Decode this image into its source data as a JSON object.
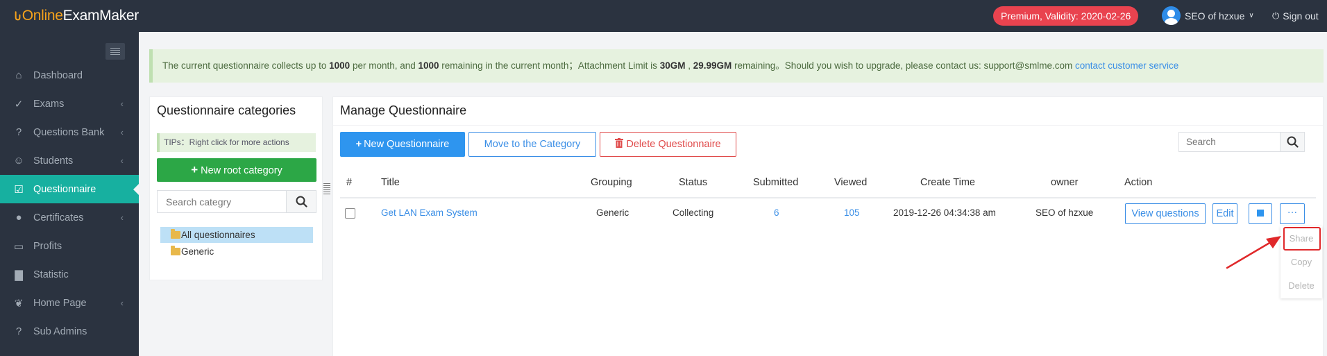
{
  "app": {
    "name_part1": "Online",
    "name_part2": "ExamMaker"
  },
  "header": {
    "premium": "Premium, Validity: 2020-02-26",
    "user": "SEO of hzxue",
    "signout": "Sign out"
  },
  "sidebar": {
    "items": [
      {
        "label": "Dashboard",
        "icon": "home-icon"
      },
      {
        "label": "Exams",
        "icon": "check-circle-icon"
      },
      {
        "label": "Questions Bank",
        "icon": "question-circle-icon"
      },
      {
        "label": "Students",
        "icon": "user-icon"
      },
      {
        "label": "Questionnaire",
        "icon": "checkbox-icon"
      },
      {
        "label": "Certificates",
        "icon": "certificate-icon"
      },
      {
        "label": "Profits",
        "icon": "card-icon"
      },
      {
        "label": "Statistic",
        "icon": "bar-chart-icon"
      },
      {
        "label": "Home Page",
        "icon": "leaf-icon"
      },
      {
        "label": "Sub Admins",
        "icon": "question-circle-icon"
      }
    ]
  },
  "notice": {
    "t1": "The current questionnaire collects up to ",
    "n1": "1000",
    "t2": " per month, and ",
    "n2": "1000",
    "t3": " remaining in the current month；Attachment Limit is ",
    "n3": "30GM",
    "t4": " , ",
    "n4": "29.99GM",
    "t5": " remaining。Should you wish to upgrade, please contact us: support@smlme.com ",
    "link": "contact customer service"
  },
  "categories": {
    "title": "Questionnaire categories",
    "tips": "TIPs：Right click for more actions",
    "new_root": "New root category",
    "search_placeholder": "Search categry",
    "items": [
      "All questionnaires",
      "Generic"
    ]
  },
  "manage": {
    "title": "Manage Questionnaire",
    "btn_new": "New Questionnaire",
    "btn_move": "Move to the Category",
    "btn_delete": "Delete Questionnaire",
    "search_placeholder": "Search",
    "columns": [
      "#",
      "Title",
      "Grouping",
      "Status",
      "Submitted",
      "Viewed",
      "Create Time",
      "owner",
      "Action"
    ],
    "row": {
      "title": "Get LAN Exam System",
      "grouping": "Generic",
      "status": "Collecting",
      "submitted": "6",
      "viewed": "105",
      "create_time": "2019-12-26 04:34:38 am",
      "owner": "SEO of hzxue"
    },
    "actions": {
      "view": "View questions",
      "edit": "Edit",
      "more": "···"
    },
    "dropdown": [
      "Share",
      "Copy",
      "Delete"
    ]
  },
  "colors": {
    "active": "#17b0a0",
    "primary": "#2e95ef",
    "danger": "#e04b4b",
    "success": "#2ca746",
    "topbar": "#2b3340"
  }
}
